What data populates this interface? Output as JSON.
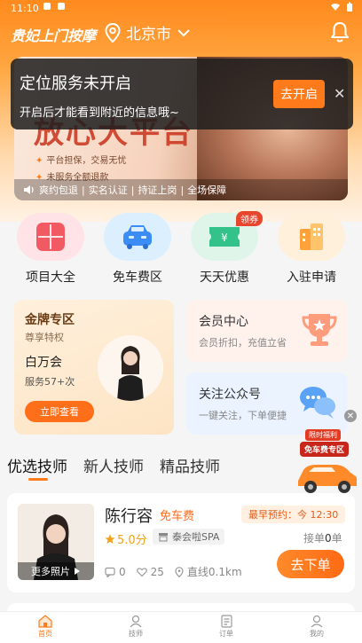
{
  "status_bar": {
    "time": "11:10"
  },
  "app_bar": {
    "brand": "贵妃上门按摩",
    "city": "北京市"
  },
  "banner": {
    "headline": "放心大平台",
    "features": [
      "平台担保，交易无忧",
      "未服务全额退款"
    ],
    "strip_items": [
      "爽约包退",
      "实名认证",
      "持证上岗",
      "全场保障"
    ],
    "strip_separator": "|"
  },
  "toast": {
    "title": "定位服务未开启",
    "message": "开启后才能看到附近的信息哦~",
    "button_label": "去开启",
    "close_glyph": "✕"
  },
  "quick_actions": [
    {
      "label": "项目大全",
      "icon": "grid-icon",
      "bg": "#ffe3e6",
      "color": "#f25a63"
    },
    {
      "label": "免车费区",
      "icon": "car-icon",
      "bg": "#dcefff",
      "color": "#3b8cf5"
    },
    {
      "label": "天天优惠",
      "icon": "ticket-icon",
      "bg": "#dff5ea",
      "color": "#33c28a",
      "badge": "领券"
    },
    {
      "label": "入驻申请",
      "icon": "building-icon",
      "bg": "#fff0dc",
      "color": "#ffa23a"
    }
  ],
  "gold_zone": {
    "title": "金牌专区",
    "subtitle": "尊享特权",
    "name": "白万会",
    "service_count": "服务57+次",
    "button_label": "立即查看"
  },
  "member_center": {
    "title": "会员中心",
    "subtitle": "会员折扣，充值立省"
  },
  "follow_account": {
    "title": "关注公众号",
    "subtitle": "一键关注，下单便捷"
  },
  "float_ad": {
    "close_glyph": "✕",
    "tag_top": "限时福利",
    "tag_main": "免车费专区"
  },
  "tabs": [
    "优选技师",
    "新人技师",
    "精品技师"
  ],
  "technician": {
    "name": "陈行容",
    "free_fare": "免车费",
    "earliest_label": "最早预约：今 12:30",
    "rating": "5.0分",
    "shop": "泰会啦SPA",
    "orders_prefix": "接单",
    "orders_count": "0",
    "orders_suffix": "单",
    "more_photos": "更多照片",
    "comments": "0",
    "likes": "25",
    "distance": "直线0.1km",
    "order_button": "去下单"
  },
  "bottom_nav": [
    {
      "label": "首页",
      "icon": "home-icon",
      "active": true
    },
    {
      "label": "技师",
      "icon": "technician-icon",
      "active": false
    },
    {
      "label": "订单",
      "icon": "order-icon",
      "active": false
    },
    {
      "label": "我的",
      "icon": "profile-icon",
      "active": false
    }
  ],
  "colors": {
    "accent": "#ff7a1a",
    "header_gradient_top": "#ff8a1e",
    "price_red": "#e8452c"
  }
}
